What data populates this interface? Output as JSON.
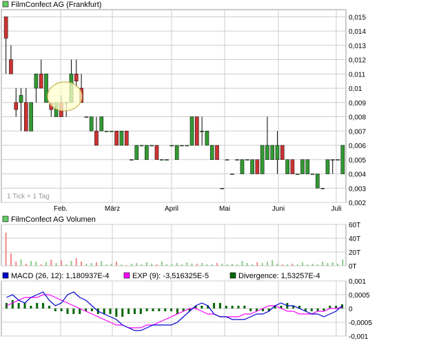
{
  "panels": {
    "price": {
      "title": "FilmConfect AG (Frankfurt)",
      "swatch_color": "#66cc66",
      "note": "1 Tick = 1 Tag",
      "y_ticks": [
        "0,015",
        "0,014",
        "0,013",
        "0,012",
        "0,011",
        "0,01",
        "0,009",
        "0,008",
        "0,007",
        "0,006",
        "0,005",
        "0,004",
        "0,003",
        "0,002"
      ]
    },
    "volume": {
      "title": "FilmConfect AG Volumen",
      "swatch_color": "#66cc66",
      "y_ticks": [
        "60T",
        "40T",
        "20T",
        "0T"
      ]
    },
    "macd": {
      "legend": [
        {
          "label": "MACD (26, 12): 1,180937E-4",
          "color": "#0000cc"
        },
        {
          "label": "EXP (9): -3,516325E-5",
          "color": "#ff00ff"
        },
        {
          "label": "Divergence: 1,53257E-4",
          "color": "#006600"
        }
      ],
      "y_ticks": [
        "0,001",
        "0,0005",
        "0",
        "-0,0005",
        "-0,001"
      ]
    }
  },
  "x_axis": {
    "month_labels": [
      "Feb.",
      "März",
      "April",
      "Mai",
      "Juni",
      "Juli"
    ]
  },
  "colors": {
    "up": "#339933",
    "down": "#cc3333",
    "macd_line": "#0000cc",
    "signal_line": "#ff00ff",
    "divergence": "#006600",
    "grid": "#cccccc",
    "highlight_fill": "#ffffcc",
    "highlight_stroke": "#c8b450"
  },
  "chart_data": [
    {
      "type": "candlestick",
      "title": "FilmConfect AG (Frankfurt)",
      "ylim": [
        0.002,
        0.0155
      ],
      "x_labels": [
        "Feb.",
        "März",
        "April",
        "Mai",
        "Juni",
        "Juli"
      ],
      "series": [
        {
          "name": "FilmConfect AG (Frankfurt)",
          "ohlc": [
            [
              0.015,
              0.015,
              0.011,
              0.0135
            ],
            [
              0.012,
              0.013,
              0.011,
              0.011
            ],
            [
              0.009,
              0.01,
              0.008,
              0.0085
            ],
            [
              0.009,
              0.01,
              0.007,
              0.0095
            ],
            [
              0.009,
              0.01,
              0.007,
              0.007
            ],
            [
              0.007,
              0.009,
              0.007,
              0.009
            ],
            [
              0.01,
              0.011,
              0.009,
              0.011
            ],
            [
              0.011,
              0.012,
              0.01,
              0.01
            ],
            [
              0.009,
              0.011,
              0.009,
              0.011
            ],
            [
              0.009,
              0.009,
              0.008,
              0.0085
            ],
            [
              0.008,
              0.009,
              0.008,
              0.009
            ],
            [
              0.009,
              0.0095,
              0.008,
              0.008
            ],
            [
              0.009,
              0.009,
              0.008,
              0.009
            ],
            [
              0.009,
              0.012,
              0.009,
              0.011
            ],
            [
              0.011,
              0.012,
              0.01,
              0.0105
            ],
            [
              0.01,
              0.011,
              0.009,
              0.009
            ],
            [
              0.008,
              0.008,
              0.008,
              0.008
            ],
            [
              0.007,
              0.008,
              0.007,
              0.008
            ],
            [
              0.007,
              0.008,
              0.006,
              0.006
            ],
            [
              0.007,
              0.008,
              0.007,
              0.008
            ],
            [
              0.007,
              0.007,
              0.007,
              0.007
            ],
            [
              0.007,
              0.007,
              0.007,
              0.007
            ],
            [
              0.007,
              0.007,
              0.006,
              0.006
            ],
            [
              0.006,
              0.007,
              0.006,
              0.007
            ],
            [
              0.007,
              0.007,
              0.006,
              0.006
            ],
            [
              0.005,
              0.005,
              0.005,
              0.005
            ],
            [
              0.005,
              0.006,
              0.005,
              0.006
            ],
            [
              0.006,
              0.006,
              0.006,
              0.006
            ],
            [
              0.005,
              0.006,
              0.005,
              0.006
            ],
            [
              0.006,
              0.006,
              0.006,
              0.006
            ],
            [
              0.006,
              0.006,
              0.005,
              0.005
            ],
            [
              0.005,
              0.005,
              0.005,
              0.005
            ],
            [
              0.005,
              0.005,
              0.005,
              0.005
            ],
            [
              0.006,
              0.006,
              0.006,
              0.006
            ],
            [
              0.005,
              0.006,
              0.005,
              0.006
            ],
            [
              0.006,
              0.006,
              0.006,
              0.006
            ],
            [
              0.006,
              0.006,
              0.006,
              0.006
            ],
            [
              0.006,
              0.008,
              0.006,
              0.008
            ],
            [
              0.008,
              0.008,
              0.006,
              0.006
            ],
            [
              0.007,
              0.008,
              0.006,
              0.007
            ],
            [
              0.006,
              0.007,
              0.006,
              0.007
            ],
            [
              0.005,
              0.006,
              0.005,
              0.006
            ],
            [
              0.006,
              0.006,
              0.005,
              0.005
            ],
            [
              0.003,
              0.003,
              0.003,
              0.003
            ],
            [
              0.005,
              0.005,
              0.005,
              0.005
            ],
            [
              0.004,
              0.004,
              0.004,
              0.004
            ],
            [
              0.005,
              0.005,
              0.005,
              0.005
            ],
            [
              0.004,
              0.005,
              0.004,
              0.005
            ],
            [
              0.005,
              0.005,
              0.005,
              0.005
            ],
            [
              0.004,
              0.005,
              0.004,
              0.005
            ],
            [
              0.005,
              0.005,
              0.004,
              0.004
            ],
            [
              0.004,
              0.006,
              0.004,
              0.006
            ],
            [
              0.005,
              0.008,
              0.005,
              0.006
            ],
            [
              0.005,
              0.006,
              0.005,
              0.006
            ],
            [
              0.005,
              0.007,
              0.004,
              0.006
            ],
            [
              0.006,
              0.006,
              0.005,
              0.005
            ],
            [
              0.004,
              0.005,
              0.004,
              0.005
            ],
            [
              0.005,
              0.005,
              0.004,
              0.004
            ],
            [
              0.004,
              0.004,
              0.004,
              0.004
            ],
            [
              0.004,
              0.005,
              0.004,
              0.005
            ],
            [
              0.004,
              0.005,
              0.004,
              0.005
            ],
            [
              0.004,
              0.004,
              0.004,
              0.004
            ],
            [
              0.003,
              0.004,
              0.003,
              0.004
            ],
            [
              0.003,
              0.003,
              0.003,
              0.003
            ],
            [
              0.004,
              0.005,
              0.004,
              0.005
            ],
            [
              0.005,
              0.005,
              0.004,
              0.005
            ],
            [
              0.005,
              0.005,
              0.005,
              0.005
            ],
            [
              0.004,
              0.006,
              0.004,
              0.006
            ]
          ]
        }
      ]
    },
    {
      "type": "bar",
      "title": "FilmConfect AG Volumen",
      "ylim": [
        0,
        60000
      ],
      "y_ticks": [
        "60T",
        "40T",
        "20T",
        "0T"
      ],
      "series": [
        {
          "name": "FilmConfect AG Volumen",
          "values": [
            48000,
            18000,
            6000,
            9000,
            3000,
            7000,
            6000,
            2000,
            5000,
            9000,
            4000,
            8000,
            2000,
            7000,
            11000,
            6000,
            3000,
            4000,
            5000,
            7000,
            2000,
            3000,
            6000,
            2000,
            1000,
            3000,
            4000,
            2000,
            5000,
            3000,
            2000,
            6000,
            2000,
            3000,
            4000,
            2000,
            5000,
            3000,
            3000,
            4000,
            2000,
            2000,
            4000,
            3000,
            2000,
            3000,
            2000,
            7000,
            4000,
            2000,
            5000,
            4000,
            6000,
            8000,
            3000,
            2000,
            2000,
            3000,
            2000,
            5000,
            2000,
            3000,
            2000,
            6000,
            4000,
            5000,
            3000,
            9000
          ]
        }
      ]
    },
    {
      "type": "line",
      "title": "",
      "ylim": [
        -0.001,
        0.001
      ],
      "y_ticks": [
        "0,001",
        "0,0005",
        "0",
        "-0,0005",
        "-0,001"
      ],
      "series": [
        {
          "name": "MACD (26, 12): 1,180937E-4",
          "values": [
            0.0004,
            0.0005,
            0.0003,
            0.0002,
            0.0004,
            0.0005,
            0.0006,
            0.0003,
            0.0001,
            0.0002,
            0.0005,
            0.0006,
            0.0004,
            0.0003,
            0.0001,
            -0.0001,
            -0.0002,
            -0.0003,
            -0.0004,
            -0.0006,
            -0.0007,
            -0.0008,
            -0.0008,
            -0.0007,
            -0.0006,
            -0.0006,
            -0.0006,
            -0.0006,
            -0.0005,
            -0.0003,
            -0.0001,
            0.0001,
            0.0002,
            0.0001,
            -0.0002,
            -0.0003,
            -0.0003,
            -0.0004,
            -0.0004,
            -0.0004,
            -0.0003,
            -0.0002,
            -0.0002,
            -0.0001,
            0.0001,
            0.0002,
            0.0001,
            0.0001,
            0.0,
            -0.0001,
            -0.0002,
            -0.0002,
            -0.0003,
            -0.0002,
            -0.0001,
            0.0001
          ]
        },
        {
          "name": "EXP (9): -3,516325E-5",
          "values": [
            0.0001,
            0.0002,
            0.0003,
            0.0004,
            0.0004,
            0.0004,
            0.0005,
            0.0005,
            0.0004,
            0.0003,
            0.0002,
            0.0001,
            0.0,
            -0.0001,
            -0.0002,
            -0.0003,
            -0.0004,
            -0.0005,
            -0.0006,
            -0.0006,
            -0.0007,
            -0.0007,
            -0.0007,
            -0.0006,
            -0.0006,
            -0.0005,
            -0.0004,
            -0.0003,
            -0.0002,
            -0.0001,
            0.0,
            0.0,
            -0.0001,
            -0.0002,
            -0.0002,
            -0.0003,
            -0.0003,
            -0.0003,
            -0.0003,
            -0.0002,
            -0.0002,
            -0.0001,
            0.0,
            0.0001,
            0.0001,
            0.0,
            -0.0001,
            -0.0001,
            -0.0002,
            -0.0002,
            -0.0002,
            -0.0001,
            -0.0001,
            0.0,
            0.0,
            4e-05
          ]
        },
        {
          "name": "Divergence: 1,53257E-4",
          "type": "bar",
          "values": [
            0.0002,
            0.0003,
            0.0002,
            0.0002,
            0.0001,
            0.0002,
            0.0002,
            0.0001,
            -0.0001,
            -0.0001,
            -0.0002,
            -0.0002,
            -0.0002,
            -0.0001,
            -0.0001,
            -0.0002,
            -0.0002,
            -0.0002,
            -0.0003,
            -0.0003,
            -0.0002,
            -0.0002,
            -0.0002,
            -0.0001,
            -0.0001,
            -0.0001,
            -0.0001,
            -0.0001,
            -0.0002,
            -0.0001,
            -0.0001,
            0.0001,
            0.0001,
            0.0001,
            0.0002,
            0.0002,
            0.0001,
            0.0001,
            0.0001,
            0.0001,
            -0.0001,
            -0.0001,
            -0.0001,
            -0.0001,
            0.0001,
            0.0001,
            0.0002,
            0.0001,
            0.0001,
            -0.0001,
            -0.0001,
            -0.0001,
            -0.0001,
            0.0001,
            0.0001,
            0.00015
          ]
        }
      ]
    }
  ]
}
